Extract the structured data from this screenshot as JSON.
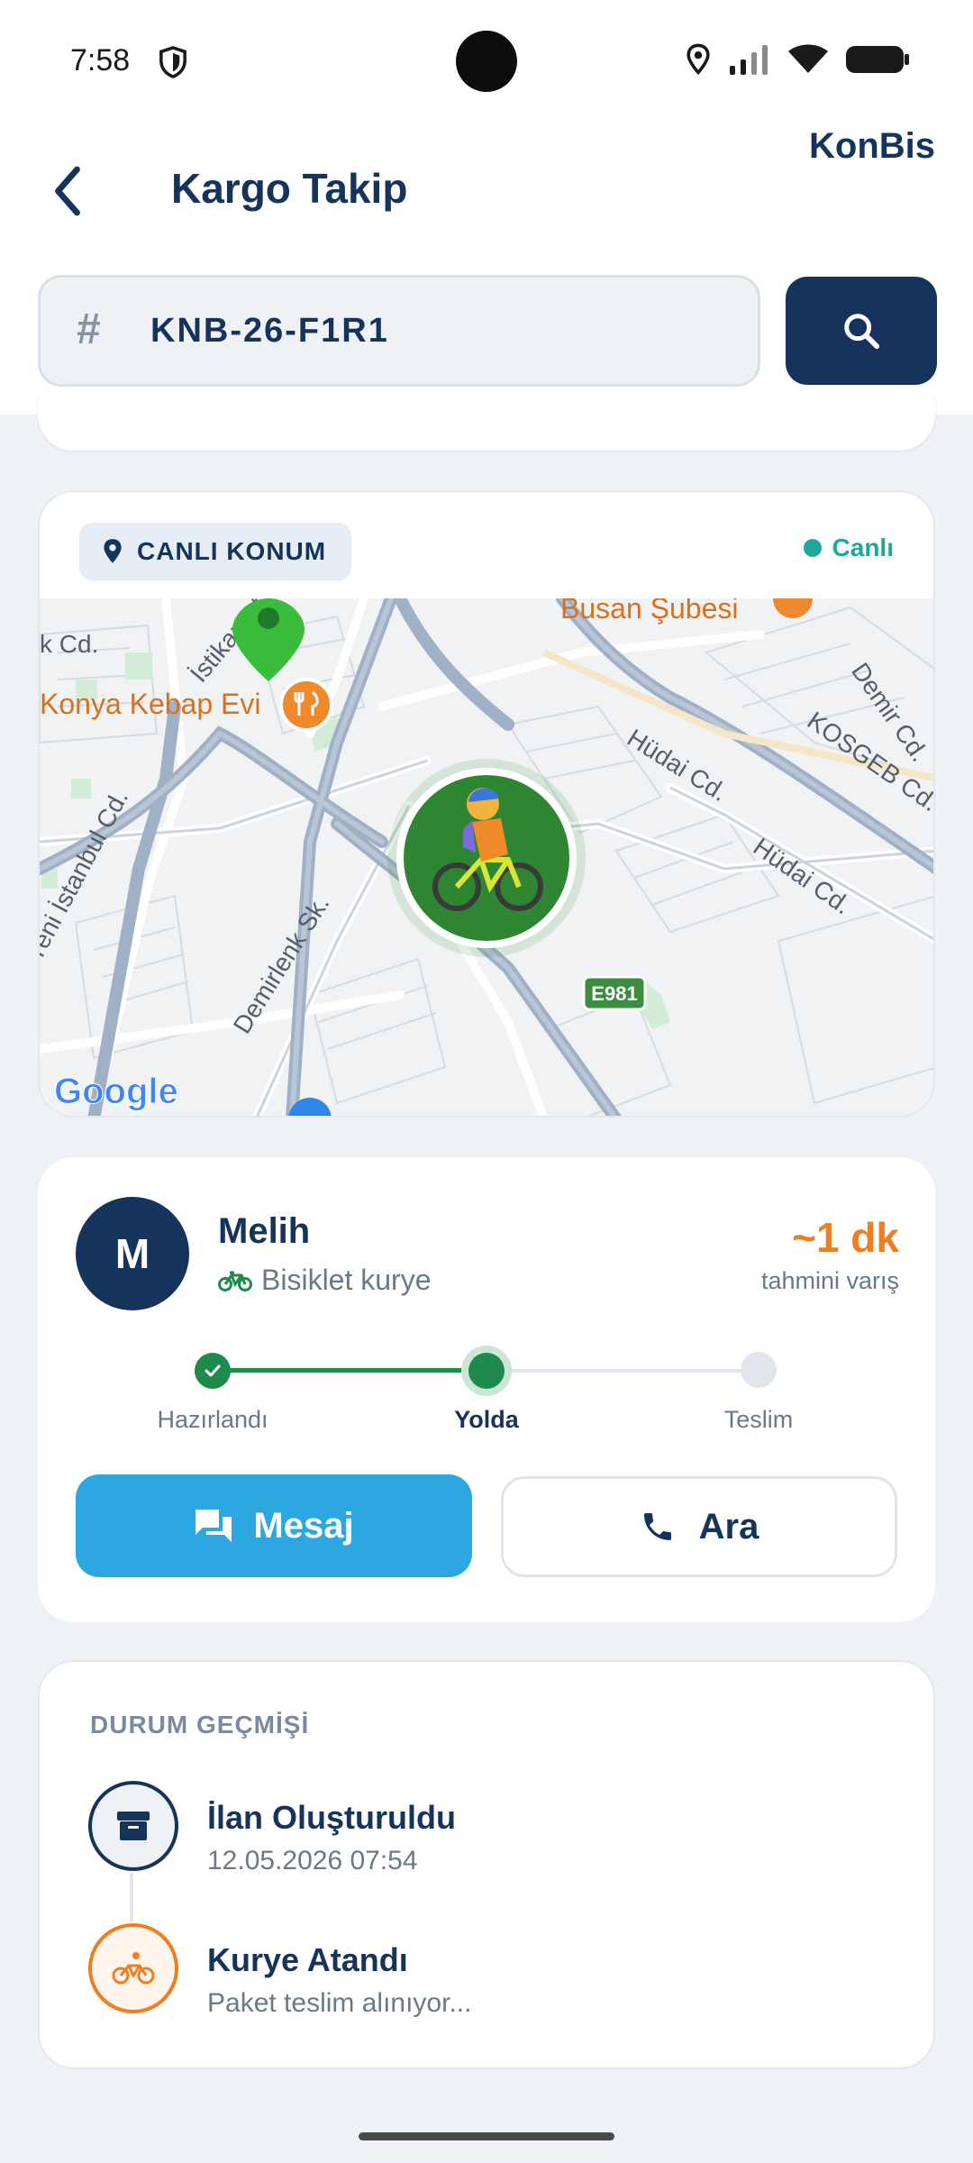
{
  "status_bar": {
    "time": "7:58"
  },
  "header": {
    "title": "Kargo Takip",
    "brand": "KonBis"
  },
  "search": {
    "value": "KNB-26-F1R1",
    "hash_symbol": "#"
  },
  "map_card": {
    "tag_label": "CANLI KONUM",
    "live_label": "Canlı",
    "map_labels": {
      "kebab": "Konya Kebap Evi",
      "busan": "Busan Şubesi",
      "istikamet": "İstikamet",
      "hudai1": "Hüdai Cd.",
      "hudai2": "Hüdai Cd.",
      "demir": "Demir Cd.",
      "kosgeb": "KOSGEB Cd.",
      "istanbul": "Yeni İstanbul Cd.",
      "demirlenk": "Demirlenk Sk.",
      "kcd": "k Cd.",
      "road_badge": "E981",
      "google": "Google"
    }
  },
  "courier": {
    "initial": "M",
    "name": "Melih",
    "type": "Bisiklet kurye",
    "eta": "~1 dk",
    "eta_label": "tahmini varış",
    "steps": [
      "Hazırlandı",
      "Yolda",
      "Teslim"
    ],
    "message_label": "Mesaj",
    "call_label": "Ara"
  },
  "history": {
    "title": "DURUM GEÇMİŞİ",
    "items": [
      {
        "title": "İlan Oluşturuldu",
        "subtitle": "12.05.2026  07:54",
        "icon": "archive-icon"
      },
      {
        "title": "Kurye Atandı",
        "subtitle": "Paket teslim alınıyor...",
        "icon": "bicycle-icon"
      }
    ]
  },
  "colors": {
    "navy": "#15335b",
    "accent_orange": "#ef7d22",
    "message_blue": "#2da7e0",
    "done_green": "#1e8a4c",
    "live_teal": "#1fa89a"
  }
}
